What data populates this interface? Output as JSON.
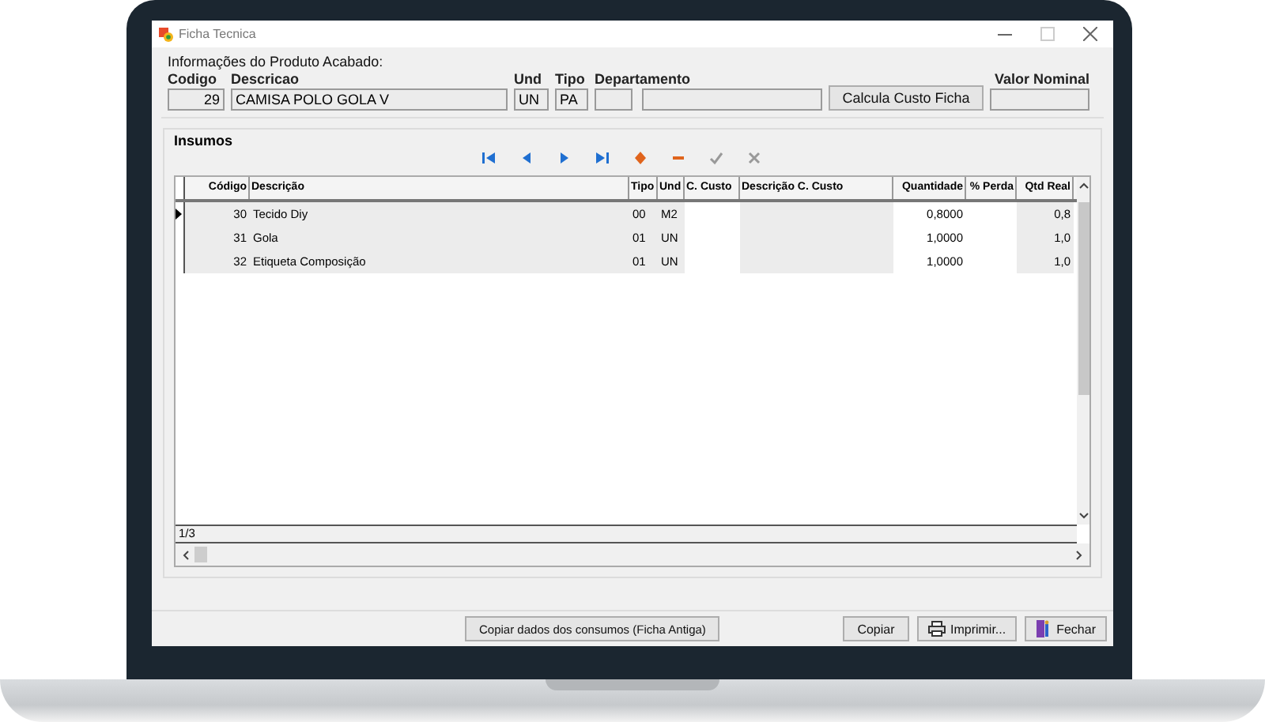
{
  "window": {
    "title": "Ficha Tecnica"
  },
  "product": {
    "heading": "Informações do Produto Acabado:",
    "codigo": {
      "label": "Codigo",
      "value": "29"
    },
    "descricao": {
      "label": "Descricao",
      "value": "CAMISA POLO GOLA V"
    },
    "und": {
      "label": "Und",
      "value": "UN"
    },
    "tipo": {
      "label": "Tipo",
      "value": "PA"
    },
    "departamento": {
      "label": "Departamento"
    },
    "calc_button": "Calcula Custo Ficha",
    "valor_nominal": {
      "label": "Valor Nominal"
    }
  },
  "insumos": {
    "title": "Insumos",
    "navigator": [
      {
        "kind": "first",
        "disabled": false
      },
      {
        "kind": "prior",
        "disabled": false
      },
      {
        "kind": "next",
        "disabled": false
      },
      {
        "kind": "last",
        "disabled": false
      },
      {
        "kind": "insert",
        "disabled": false
      },
      {
        "kind": "delete",
        "disabled": false
      },
      {
        "kind": "post",
        "disabled": true
      },
      {
        "kind": "cancel",
        "disabled": true
      }
    ],
    "columns": [
      {
        "label": "Código",
        "kind": "number"
      },
      {
        "label": "Descrição",
        "kind": "text"
      },
      {
        "label": "Tipo",
        "kind": "text"
      },
      {
        "label": "Und",
        "kind": "text"
      },
      {
        "label": "C. Custo",
        "kind": "text"
      },
      {
        "label": "Descrição C. Custo",
        "kind": "text"
      },
      {
        "label": "Quantidade",
        "kind": "number"
      },
      {
        "label": "% Perda",
        "kind": "number"
      },
      {
        "label": "Qtd Real",
        "kind": "number"
      }
    ],
    "rows": [
      {
        "selected": true,
        "cells": [
          "30",
          "Tecido Diy",
          "00",
          "M2",
          null,
          null,
          "0,8000",
          null,
          "0,8"
        ]
      },
      {
        "selected": false,
        "cells": [
          "31",
          "Gola",
          "01",
          "UN",
          null,
          null,
          "1,0000",
          null,
          "1,0"
        ]
      },
      {
        "selected": false,
        "cells": [
          "32",
          "Etiqueta Composição",
          "01",
          "UN",
          null,
          null,
          "1,0000",
          null,
          "1,0"
        ]
      }
    ],
    "status": "1/3"
  },
  "footer": {
    "copy_old_button": "Copiar dados dos consumos (Ficha Antiga)",
    "buttons": [
      {
        "kind": "copy",
        "label": "Copiar"
      },
      {
        "kind": "print",
        "label": "Imprimir..."
      },
      {
        "kind": "close",
        "label": "Fechar"
      }
    ]
  }
}
